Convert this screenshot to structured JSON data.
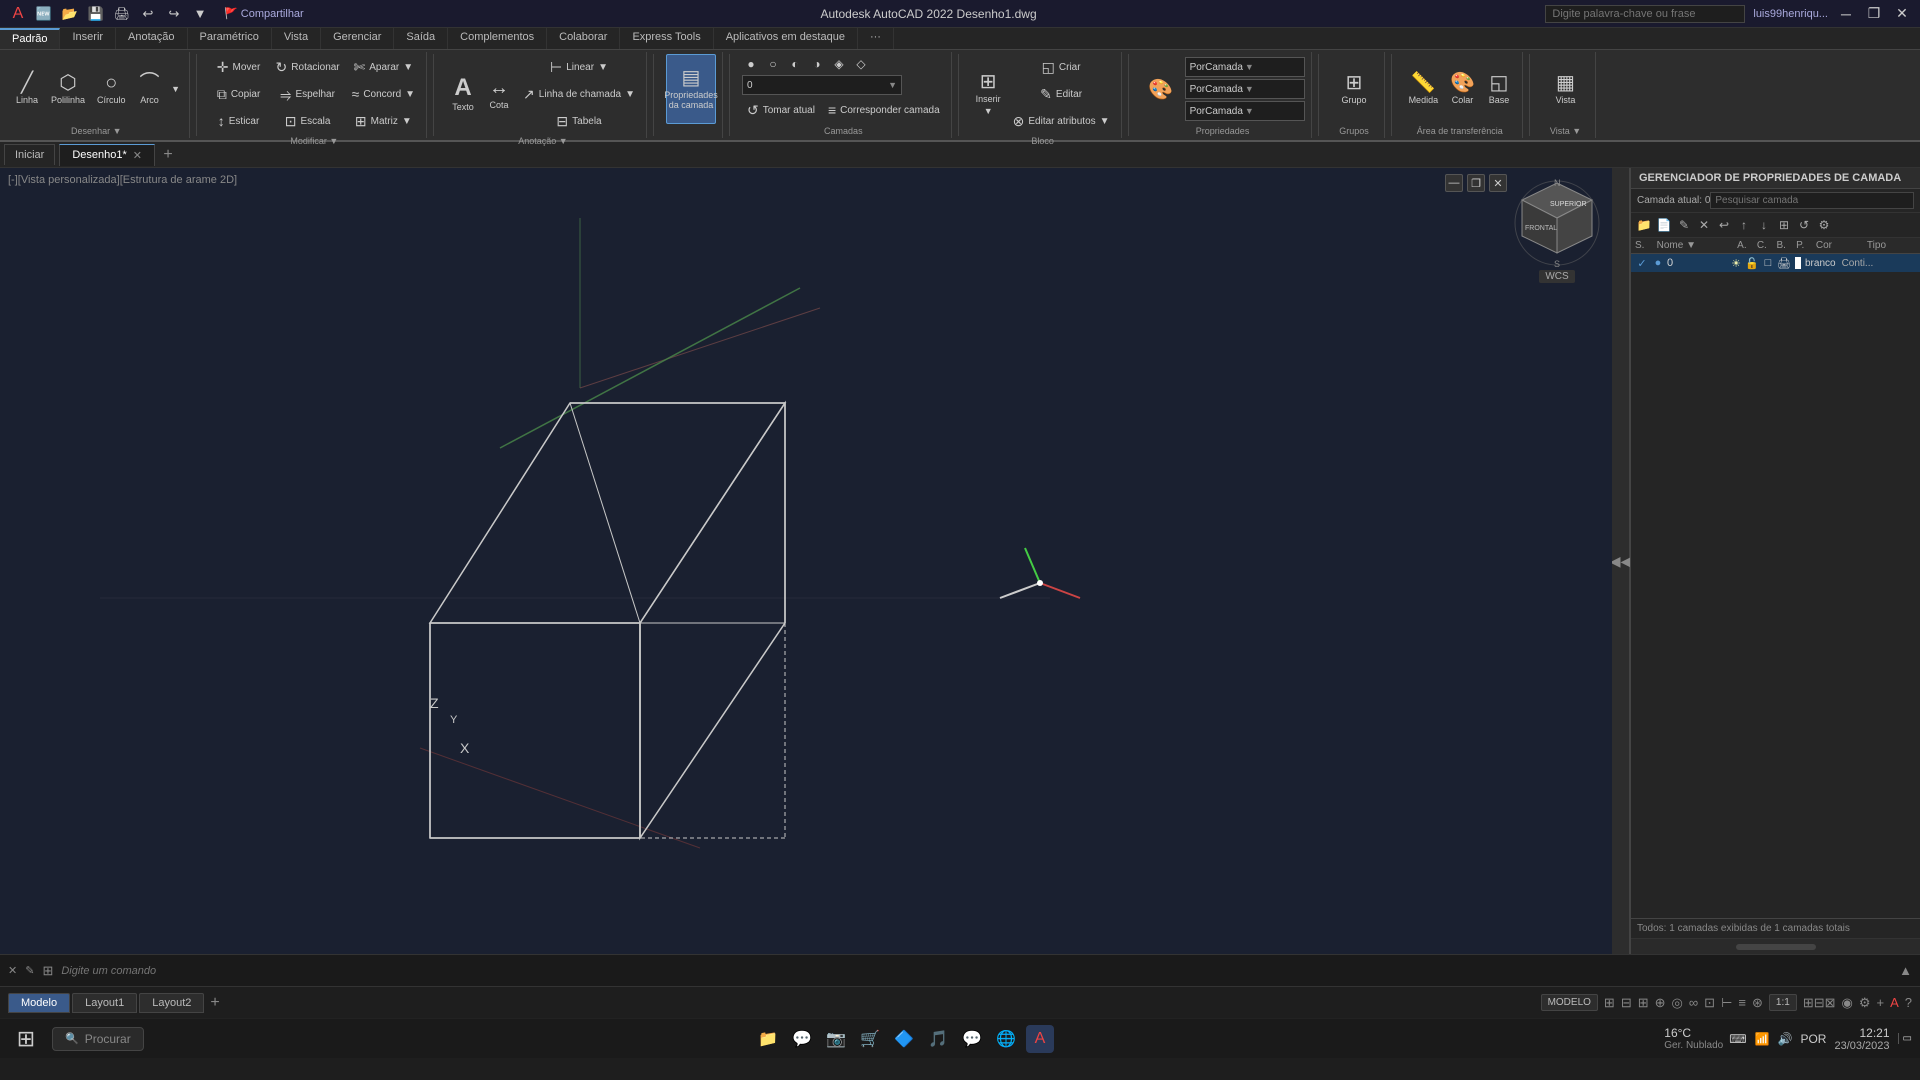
{
  "titleBar": {
    "appTitle": "Autodesk AutoCAD 2022  Desenho1.dwg",
    "searchPlaceholder": "Digite palavra-chave ou frase",
    "userLabel": "luis99henriqu...",
    "windowBtns": [
      "—",
      "❐",
      "✕"
    ]
  },
  "quickAccess": {
    "buttons": [
      "🆕",
      "📂",
      "💾",
      "🖨",
      "↩",
      "↪",
      "⚙"
    ],
    "shareLabel": "🚩 Compartilhar"
  },
  "ribbon": {
    "tabs": [
      "Padrão",
      "Inserir",
      "Anotação",
      "Paramétrico",
      "Vista",
      "Gerenciar",
      "Saída",
      "Complementos",
      "Colaborar",
      "Express Tools",
      "Aplicativos em destaque",
      "..."
    ],
    "activeTab": "Padrão",
    "groups": [
      {
        "label": "Desenhar",
        "items": [
          {
            "icon": "╱",
            "label": "Linha"
          },
          {
            "icon": "⬡",
            "label": "Polilinha"
          },
          {
            "icon": "○",
            "label": "Círculo"
          },
          {
            "icon": "⌒",
            "label": "Arco"
          }
        ]
      },
      {
        "label": "Modificar",
        "items": [
          {
            "icon": "↔",
            "label": "Mover"
          },
          {
            "icon": "↻",
            "label": "Rotacionar"
          },
          {
            "icon": "✄",
            "label": "Aparar"
          },
          {
            "icon": "⧉",
            "label": "Copiar"
          },
          {
            "icon": "⥤",
            "label": "Espelhar"
          },
          {
            "icon": "≈",
            "label": "Concord"
          },
          {
            "icon": "↕",
            "label": "Esticar"
          },
          {
            "icon": "⊡",
            "label": "Escala"
          },
          {
            "icon": "⊞",
            "label": "Matriz"
          }
        ]
      },
      {
        "label": "Anotação",
        "items": [
          {
            "icon": "A",
            "label": "Texto"
          },
          {
            "icon": "⊢",
            "label": "Cota"
          },
          {
            "icon": "↗",
            "label": "Linha de chamada",
            "wide": true
          },
          {
            "icon": "≡",
            "label": "Tabela"
          },
          {
            "icon": "—",
            "label": "Linear"
          }
        ]
      },
      {
        "label": "",
        "items": [
          {
            "icon": "▦",
            "label": "Propriedades da camada",
            "active": true
          }
        ]
      },
      {
        "label": "Camadas",
        "items": [
          {
            "icon": "▥",
            "label": ""
          },
          {
            "icon": "✎",
            "label": ""
          },
          {
            "icon": "↺",
            "label": "Tomar atual"
          },
          {
            "icon": "≡",
            "label": "Corresponder camada"
          }
        ]
      },
      {
        "label": "Bloco",
        "items": [
          {
            "icon": "⊞",
            "label": "Inserir"
          },
          {
            "icon": "◱",
            "label": "Criar"
          },
          {
            "icon": "✎",
            "label": "Editar"
          },
          {
            "icon": "⊗",
            "label": "Editar atributos"
          }
        ]
      },
      {
        "label": "Propriedades",
        "items": [
          {
            "icon": "🔲",
            "label": "Corresponder propriedades"
          },
          {
            "icon": "≡",
            "label": "PorCamada"
          },
          {
            "icon": "≡",
            "label": "PorCamada"
          },
          {
            "icon": "≡",
            "label": "PorCamada"
          }
        ]
      },
      {
        "label": "Grupos",
        "items": [
          {
            "icon": "⊞",
            "label": "Grupo"
          },
          {
            "icon": "📏",
            "label": "Medida"
          }
        ]
      },
      {
        "label": "",
        "items": [
          {
            "icon": "🎨",
            "label": "Colar"
          },
          {
            "icon": "📋",
            "label": "Base"
          }
        ]
      }
    ]
  },
  "docTabs": {
    "tabs": [
      {
        "label": "Iniciar",
        "closeable": false
      },
      {
        "label": "Desenho1*",
        "closeable": true,
        "active": true
      }
    ],
    "newTabLabel": "+"
  },
  "viewport": {
    "label": "[-][Vista personalizada][Estrutura de arame 2D]",
    "wcsLabel": "WCS",
    "backgroundColor": "#1a2030"
  },
  "viewcube": {
    "faces": [
      "SUPERIOR",
      "FRONTAL"
    ]
  },
  "layerPanel": {
    "title": "GERENCIADOR DE PROPRIEDADES DE CAMADA",
    "currentLayer": "Camada atual: 0",
    "searchPlaceholder": "Pesquisar camada",
    "columns": [
      "S.",
      "Nome",
      "A.",
      "C.",
      "B.",
      "P.",
      "Cor",
      "Tipo"
    ],
    "rows": [
      {
        "status": "✓",
        "name": "0",
        "a": "☀",
        "c": "🔒",
        "b": "□",
        "p": "□",
        "cor": "branco",
        "tipo": "Conti..."
      }
    ],
    "footer": "Todos: 1 camadas exibidas de 1 camadas totais",
    "toolIcons": [
      "📁",
      "📄",
      "✎",
      "✕",
      "↩",
      "↑",
      "↓",
      "⊞",
      "⊠"
    ]
  },
  "commandLine": {
    "placeholder": "Digite um comando"
  },
  "statusTabs": {
    "tabs": [
      "Modelo",
      "Layout1",
      "Layout2"
    ],
    "activeTab": "Modelo"
  },
  "statusBar": {
    "modelLabel": "MODELO",
    "zoomLevel": "1:1",
    "icons": [
      "grid",
      "snap",
      "ortho",
      "polar",
      "osnap",
      "otrack",
      "ducs",
      "dyn",
      "lw",
      "tp"
    ]
  },
  "taskbar": {
    "windowsIcon": "⊞",
    "searchLabel": "Procurar",
    "apps": [
      "📁",
      "💬",
      "📷",
      "🛒",
      "🔷",
      "🎵",
      "💬",
      "🌐",
      "🔴"
    ],
    "systemTray": {
      "icons": [
        "⌨",
        "📶",
        "🔊"
      ],
      "language": "POR",
      "time": "12:21",
      "date": "23/03/2023"
    },
    "weather": {
      "temp": "16°C",
      "desc": "Ger. Nublado"
    }
  }
}
